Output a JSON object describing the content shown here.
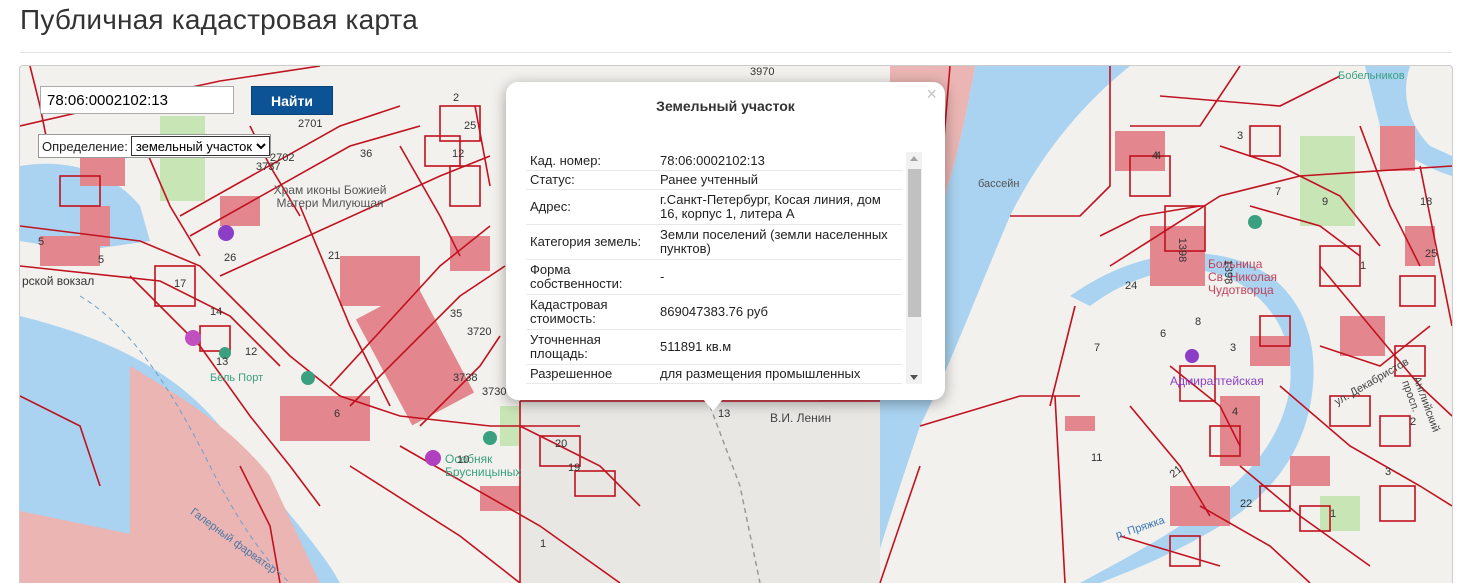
{
  "page": {
    "title": "Публичная кадастровая карта"
  },
  "search": {
    "value": "78:06:0002102:13",
    "button_label": "Найти"
  },
  "definition": {
    "label": "Определение:",
    "selected": "земельный участок"
  },
  "popup": {
    "title": "Земельный участок",
    "close_symbol": "×",
    "rows": [
      {
        "key": "Кад. номер:",
        "value": "78:06:0002102:13"
      },
      {
        "key": "Статус:",
        "value": "Ранее учтенный"
      },
      {
        "key": "Адрес:",
        "value": "г.Санкт-Петербург, Косая линия, дом 16, корпус 1, литера А"
      },
      {
        "key": "Категория земель:",
        "value": "Земли поселений (земли населенных пунктов)"
      },
      {
        "key": "Форма собственности:",
        "value": "-"
      },
      {
        "key": "Кадастровая стоимость:",
        "value": "869047383.76 руб"
      },
      {
        "key": "Уточненная площадь:",
        "value": "511891 кв.м"
      },
      {
        "key": "Разрешенное",
        "value": "для размещения промышленных"
      }
    ]
  },
  "map_labels": {
    "church": "Храм иконы Божией Матери Милующая",
    "station": "рской вокзал",
    "lenin": "В.И. Ленин",
    "admiralteyskaya": "Адмиралтейская",
    "bolnitsa": "Больница Св. Николая Чудотворца",
    "fairway": "Галерный фарватер",
    "bobelnikov": "Бобельников",
    "basin": "бассейн",
    "pryazhka": "р. Пряжка",
    "osobnyak": "Особняк Брусницыных",
    "bel_port": "Бель Порт",
    "dekabristov": "ул. Декабристов",
    "anglijskij": "Английский просп.",
    "parcel_numbers": [
      "3737",
      "2701",
      "2702",
      "36",
      "21",
      "26",
      "5",
      "17",
      "14",
      "12",
      "13",
      "6",
      "35",
      "3720",
      "3738",
      "3730",
      "20",
      "19",
      "10",
      "1",
      "2",
      "25",
      "12",
      "4",
      "3",
      "7",
      "1398",
      "1398",
      "24",
      "8",
      "6",
      "3",
      "4",
      "7",
      "11",
      "21",
      "4",
      "9",
      "18",
      "25",
      "1",
      "2",
      "3",
      "1",
      "22",
      "13",
      "3970",
      "5"
    ]
  },
  "colors": {
    "accent": "#0b5394",
    "parcel_line": "#c1121f",
    "parcel_fill": "#e8a0a2",
    "water": "#a9d3f0",
    "building": "#e3868d"
  }
}
